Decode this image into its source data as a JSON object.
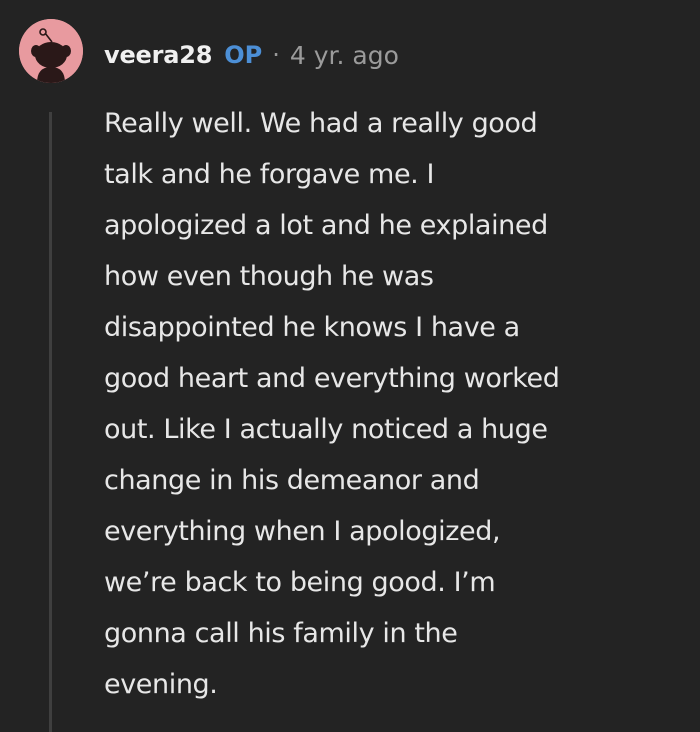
{
  "comment": {
    "username": "veera28",
    "op_badge": "OP",
    "separator": "·",
    "timestamp": "4 yr. ago",
    "lines": [
      "Really well. We had a really good",
      "talk and he forgave me. I",
      "apologized a lot and he explained",
      "how even though he was",
      "disappointed he knows I have a",
      "good heart and everything worked",
      "out. Like I actually noticed a huge",
      "change in his demeanor and",
      "everything when I apologized,",
      "we’re back to being good. I’m",
      "gonna call his family in the",
      "evening."
    ]
  },
  "colors": {
    "background": "#232323",
    "avatar": "#e89a9f",
    "op_accent": "#4c8fd6",
    "thread_line": "#3f3f3f"
  },
  "icons": {
    "avatar": "reddit-snoo-avatar-icon"
  }
}
